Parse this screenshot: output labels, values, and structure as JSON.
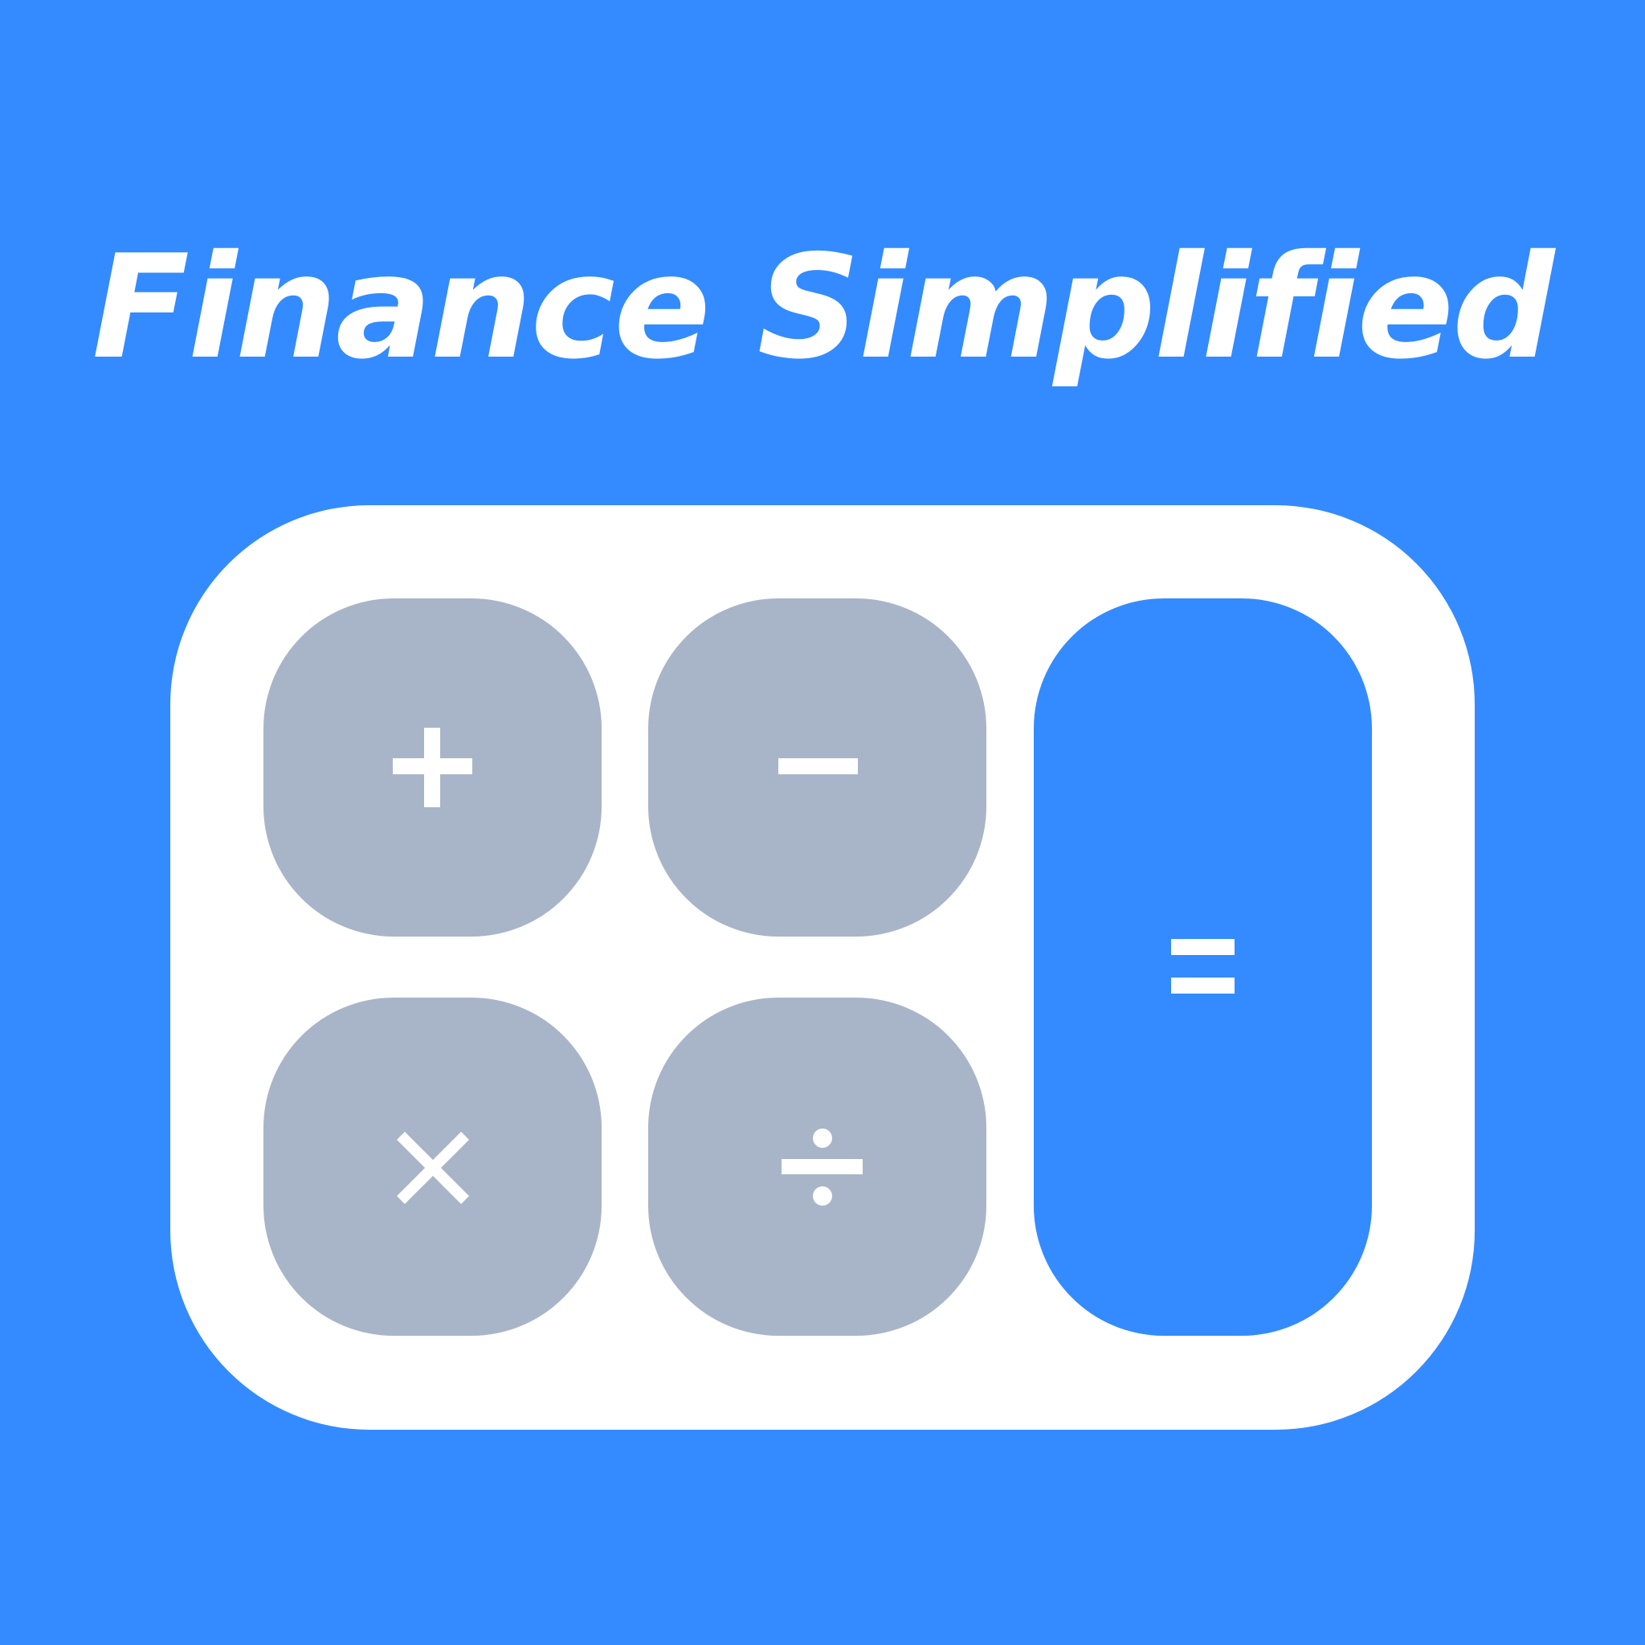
{
  "app": {
    "title": "Finance Simplified"
  },
  "keypad": {
    "keys": [
      {
        "icon": "plus-icon",
        "symbol": "+"
      },
      {
        "icon": "minus-icon",
        "symbol": "−"
      },
      {
        "icon": "equals-icon",
        "symbol": "="
      },
      {
        "icon": "multiply-icon",
        "symbol": "×"
      },
      {
        "icon": "divide-icon",
        "symbol": "÷"
      }
    ]
  },
  "colors": {
    "background": "#338BFF",
    "card": "#FFFFFF",
    "operator_key": "#A8B5C8",
    "equals_key": "#338BFF",
    "symbol": "#FFFFFF"
  }
}
